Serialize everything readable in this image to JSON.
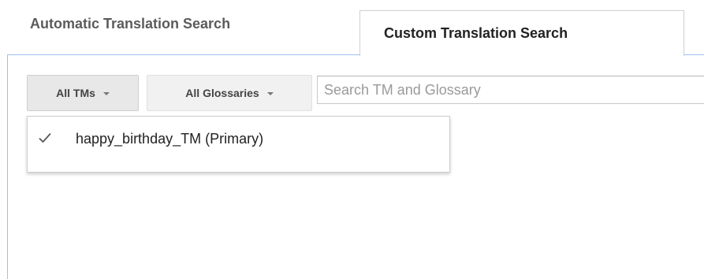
{
  "tabs": {
    "automatic": "Automatic Translation Search",
    "custom": "Custom Translation Search"
  },
  "toolbar": {
    "tms_button": "All TMs",
    "glossaries_button": "All Glossaries",
    "search_placeholder": "Search TM and Glossary",
    "search_value": ""
  },
  "tm_menu": {
    "items": [
      {
        "label": "happy_birthday_TM (Primary)",
        "checked": true,
        "icon": "check-icon"
      }
    ]
  },
  "colors": {
    "panel_border": "#9cc0ef",
    "tab_border": "#d0d0d0",
    "button_bg": "#f1f1f1"
  }
}
